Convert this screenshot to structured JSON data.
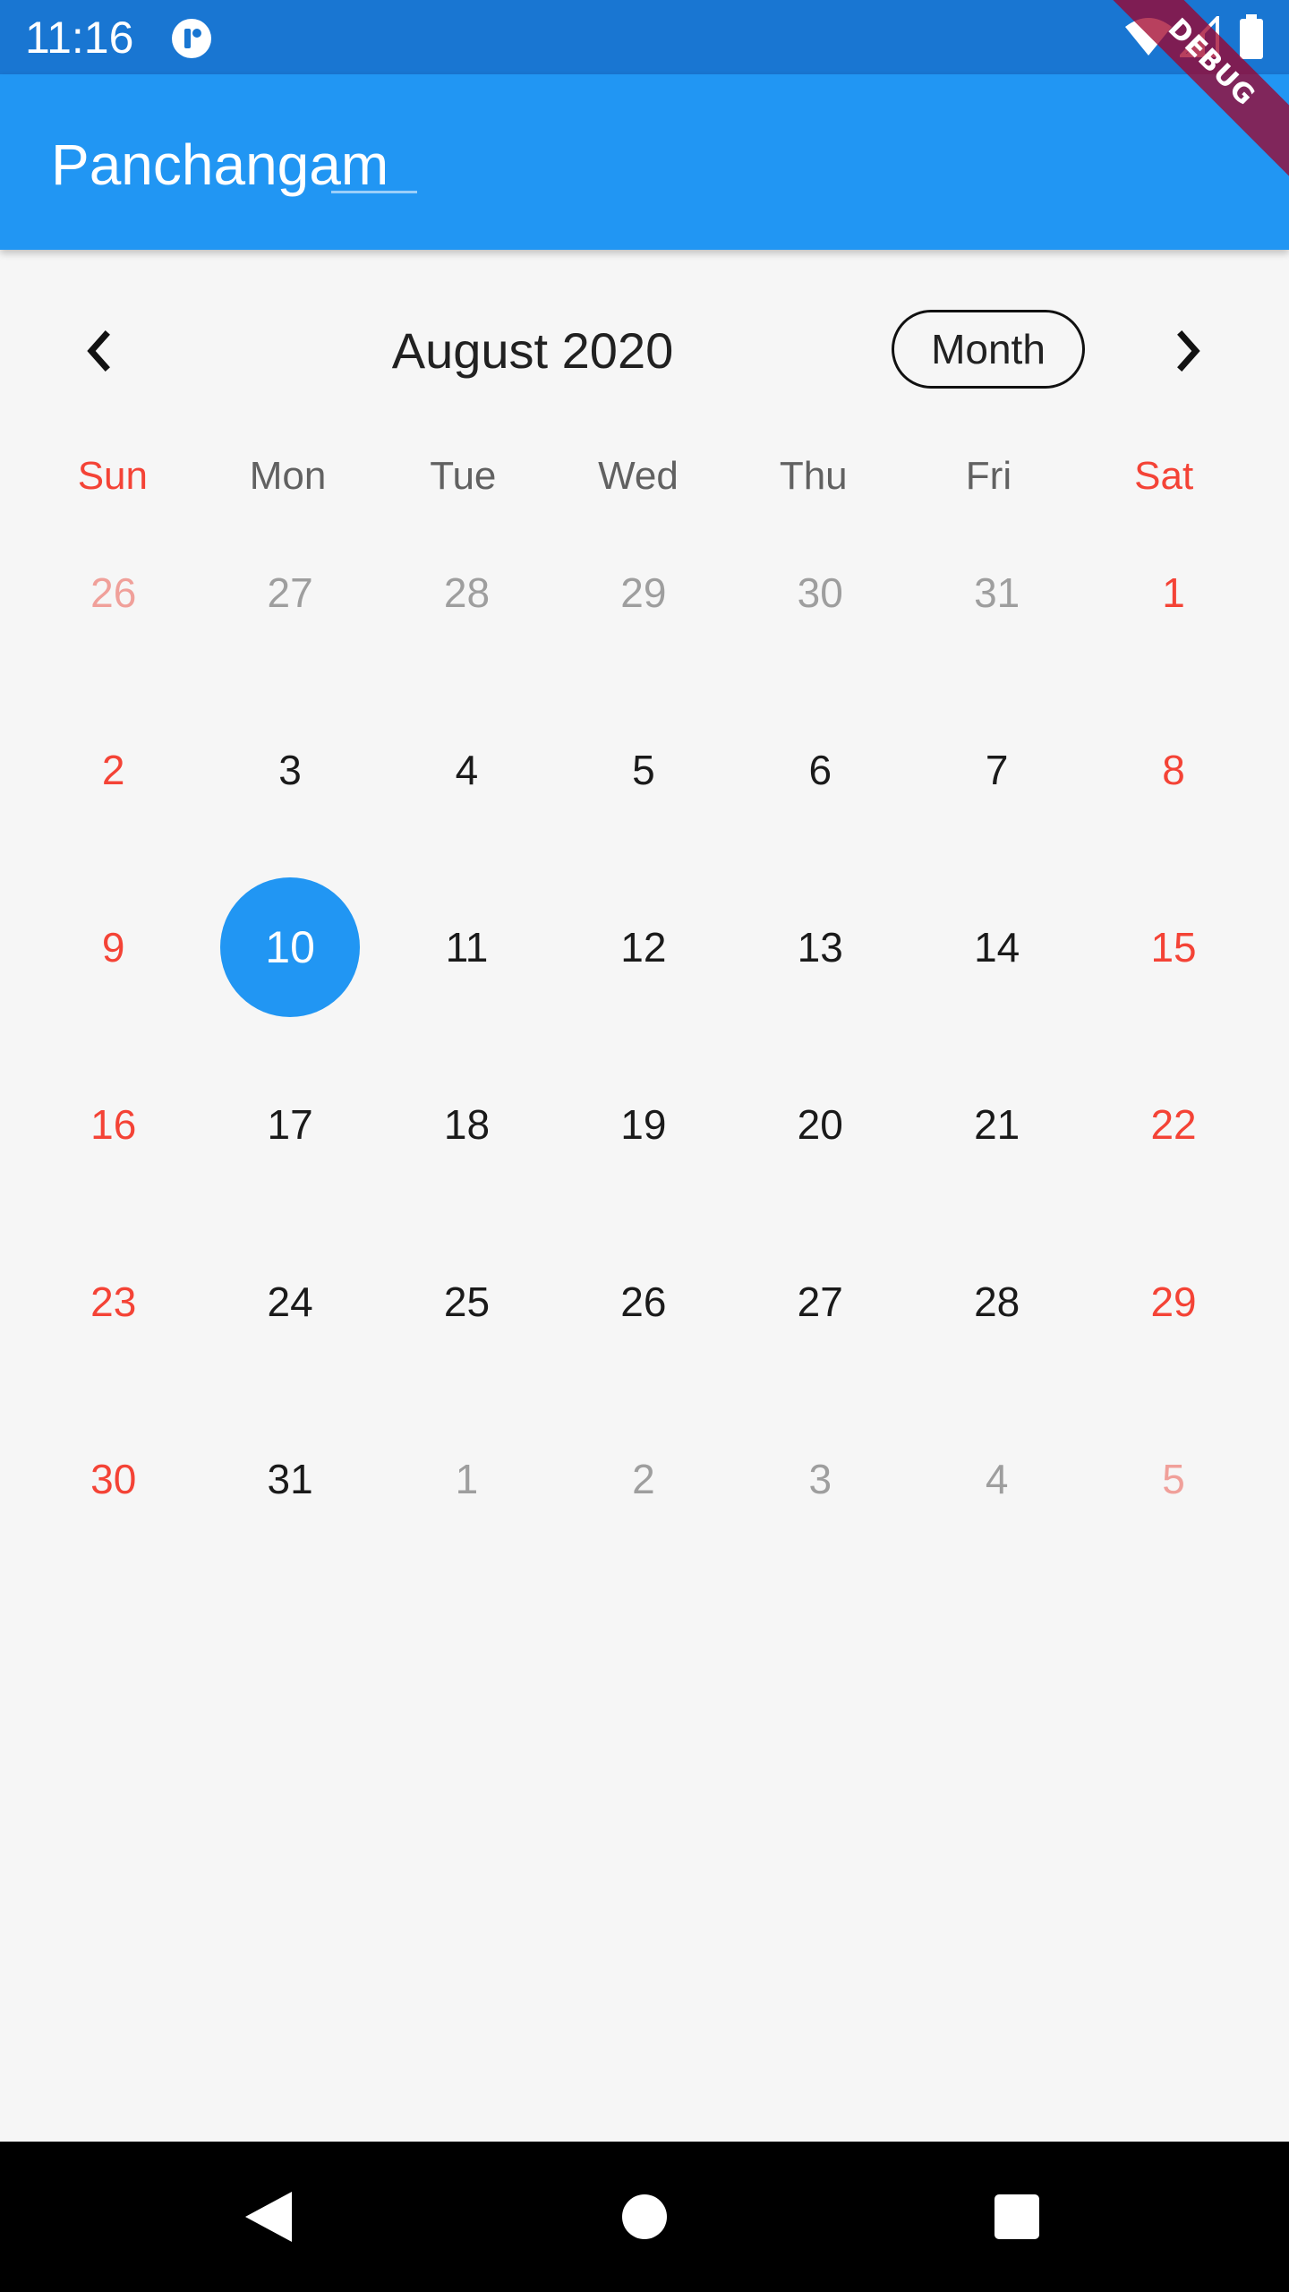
{
  "status_bar": {
    "time": "11:16",
    "icons": [
      "notification-icon",
      "wifi-icon",
      "signal-icon",
      "battery-icon"
    ]
  },
  "app_bar": {
    "title": "Panchangam",
    "color": "#2196f3"
  },
  "debug_banner": {
    "label": "DEBUG"
  },
  "calendar": {
    "month_title": "August 2020",
    "view_toggle_label": "Month",
    "prev_icon": "chevron-left-icon",
    "next_icon": "chevron-right-icon",
    "weekdays": [
      "Sun",
      "Mon",
      "Tue",
      "Wed",
      "Thu",
      "Fri",
      "Sat"
    ],
    "selected_day": "10",
    "selected_color": "#2196f3",
    "weekend_color": "#f44336",
    "weeks": [
      [
        {
          "day": "26",
          "current_month": false
        },
        {
          "day": "27",
          "current_month": false
        },
        {
          "day": "28",
          "current_month": false
        },
        {
          "day": "29",
          "current_month": false
        },
        {
          "day": "30",
          "current_month": false
        },
        {
          "day": "31",
          "current_month": false
        },
        {
          "day": "1",
          "current_month": true
        }
      ],
      [
        {
          "day": "2",
          "current_month": true
        },
        {
          "day": "3",
          "current_month": true
        },
        {
          "day": "4",
          "current_month": true
        },
        {
          "day": "5",
          "current_month": true
        },
        {
          "day": "6",
          "current_month": true
        },
        {
          "day": "7",
          "current_month": true
        },
        {
          "day": "8",
          "current_month": true
        }
      ],
      [
        {
          "day": "9",
          "current_month": true
        },
        {
          "day": "10",
          "current_month": true,
          "selected": true
        },
        {
          "day": "11",
          "current_month": true
        },
        {
          "day": "12",
          "current_month": true
        },
        {
          "day": "13",
          "current_month": true
        },
        {
          "day": "14",
          "current_month": true
        },
        {
          "day": "15",
          "current_month": true
        }
      ],
      [
        {
          "day": "16",
          "current_month": true
        },
        {
          "day": "17",
          "current_month": true
        },
        {
          "day": "18",
          "current_month": true
        },
        {
          "day": "19",
          "current_month": true
        },
        {
          "day": "20",
          "current_month": true
        },
        {
          "day": "21",
          "current_month": true
        },
        {
          "day": "22",
          "current_month": true
        }
      ],
      [
        {
          "day": "23",
          "current_month": true
        },
        {
          "day": "24",
          "current_month": true
        },
        {
          "day": "25",
          "current_month": true
        },
        {
          "day": "26",
          "current_month": true
        },
        {
          "day": "27",
          "current_month": true
        },
        {
          "day": "28",
          "current_month": true
        },
        {
          "day": "29",
          "current_month": true
        }
      ],
      [
        {
          "day": "30",
          "current_month": true
        },
        {
          "day": "31",
          "current_month": true
        },
        {
          "day": "1",
          "current_month": false
        },
        {
          "day": "2",
          "current_month": false
        },
        {
          "day": "3",
          "current_month": false
        },
        {
          "day": "4",
          "current_month": false
        },
        {
          "day": "5",
          "current_month": false
        }
      ]
    ]
  },
  "nav_bar": {
    "buttons": [
      "back-icon",
      "home-icon",
      "recents-icon"
    ]
  }
}
